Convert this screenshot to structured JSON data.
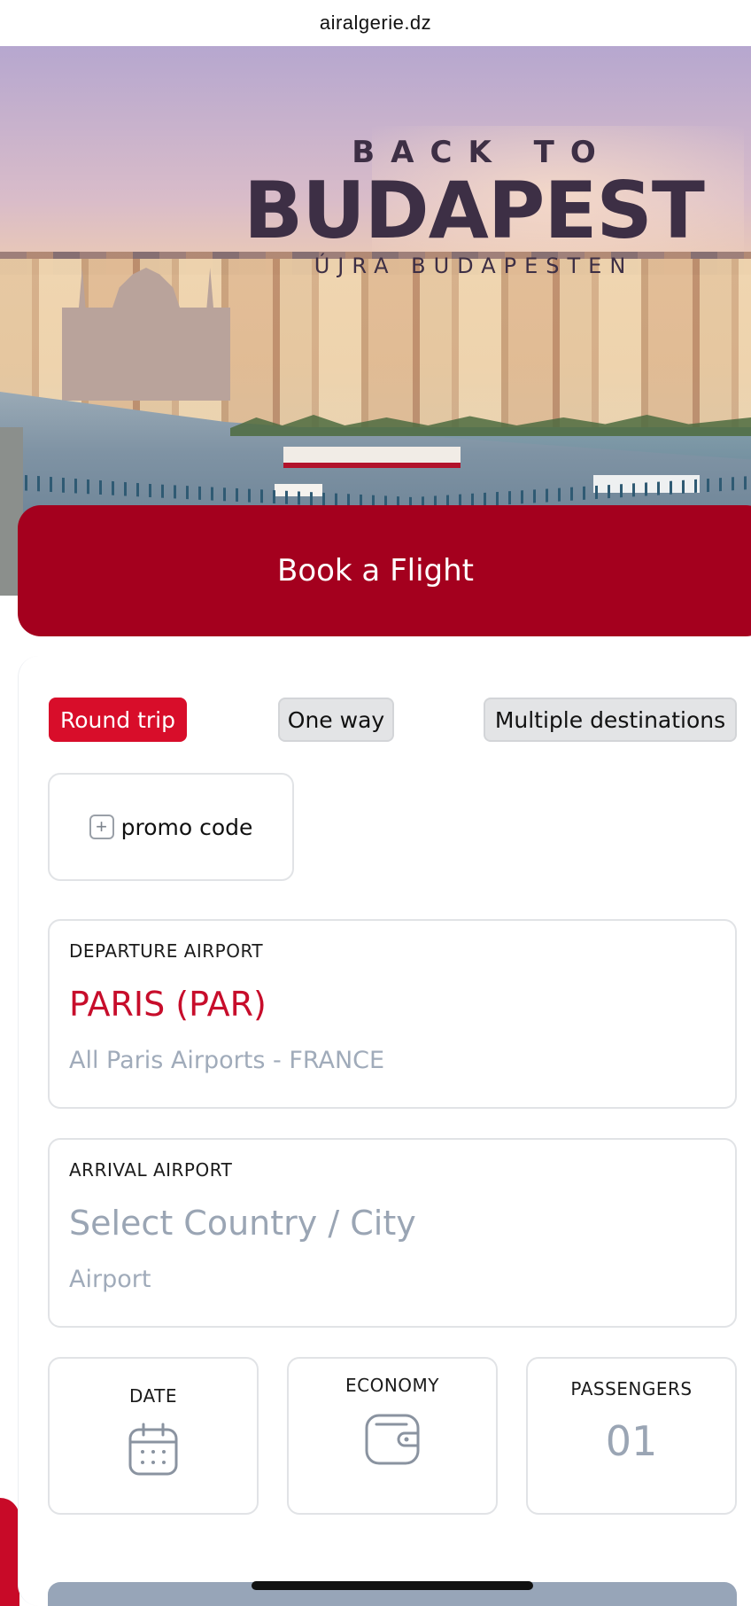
{
  "browser": {
    "url": "airalgerie.dz"
  },
  "hero": {
    "pretitle": "BACK TO",
    "title": "BUDAPEST",
    "subtitle": "ÚJRA BUDAPESTEN"
  },
  "booking": {
    "banner_label": "Book a Flight",
    "trip_types": [
      "Round trip",
      "One way",
      "Multiple destinations"
    ],
    "selected_trip_type": "Round trip",
    "promo_label": "promo code",
    "departure": {
      "label": "DEPARTURE AIRPORT",
      "city": "PARIS (PAR)",
      "detail": "All Paris Airports - FRANCE"
    },
    "arrival": {
      "label": "ARRIVAL AIRPORT",
      "placeholder": "Select Country / City",
      "detail_placeholder": "Airport"
    },
    "date_label": "DATE",
    "class_label": "ECONOMY",
    "passengers_label": "PASSENGERS",
    "passengers_count": "01"
  },
  "colors": {
    "brand_red": "#a4001e",
    "active_red": "#d80d2a",
    "muted_text": "#9aa5b4"
  },
  "icons": {
    "promo": "plus-square-icon",
    "date": "calendar-icon",
    "class": "wallet-icon"
  }
}
